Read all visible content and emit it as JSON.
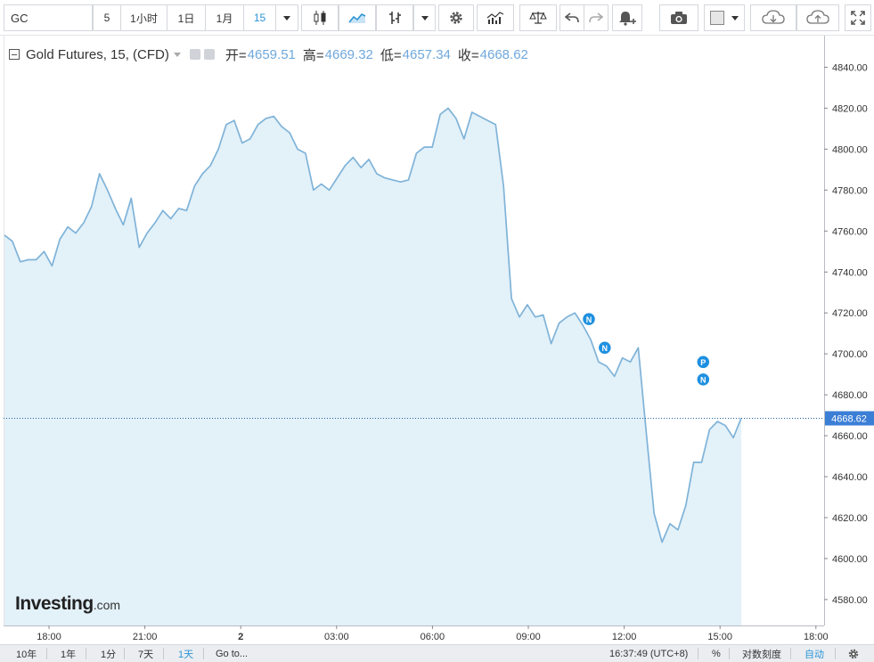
{
  "toolbar": {
    "symbol": "GC",
    "intervals": [
      "5",
      "1小时",
      "1日",
      "1月",
      "15"
    ],
    "active_interval": "15"
  },
  "legend": {
    "title": "Gold Futures, 15, (CFD)",
    "open_label": "开=",
    "open": "4659.51",
    "high_label": "高=",
    "high": "4669.32",
    "low_label": "低=",
    "low": "4657.34",
    "close_label": "收=",
    "close": "4668.62"
  },
  "logo": {
    "main": "Investing",
    "domain": ".com"
  },
  "footer": {
    "ranges": [
      "10年",
      "1年",
      "1分",
      "7天",
      "1天"
    ],
    "active_range": "1天",
    "goto": "Go to...",
    "clock": "16:37:49 (UTC+8)",
    "percent": "%",
    "log": "对数刻度",
    "auto": "自动"
  },
  "colors": {
    "line": "#7fb3d8",
    "fill": "#e3f1f9",
    "last_price_label": "#3b7ed6",
    "marker": "#1e90e0",
    "accent": "#2b95d6"
  },
  "chart_data": {
    "type": "area",
    "title": "Gold Futures, 15, (CFD)",
    "x_tick_labels": [
      "18:00",
      "21:00",
      "2",
      "03:00",
      "06:00",
      "09:00",
      "12:00",
      "15:00",
      "18:00"
    ],
    "y_ticks": [
      4580,
      4600,
      4620,
      4640,
      4660,
      4680,
      4700,
      4720,
      4740,
      4760,
      4780,
      4800,
      4820,
      4840
    ],
    "ylim": [
      4570,
      4850
    ],
    "last_price": 4668.62,
    "last_price_label": "4668.62",
    "series": [
      {
        "values": [
          4758,
          4755,
          4745,
          4746,
          4746,
          4750,
          4743,
          4756,
          4762,
          4759,
          4764,
          4772,
          4788,
          4780,
          4771,
          4763,
          4776,
          4752,
          4759,
          4764,
          4770,
          4766,
          4771,
          4770,
          4782,
          4788,
          4792,
          4800,
          4812,
          4814,
          4803,
          4805,
          4812,
          4815,
          4816,
          4811,
          4808,
          4800,
          4798,
          4780,
          4783,
          4780,
          4786,
          4792,
          4796,
          4791,
          4795,
          4788,
          4786,
          4785,
          4784,
          4785,
          4798,
          4801,
          4801,
          4817,
          4820,
          4815,
          4805,
          4818,
          4816,
          4814,
          4812,
          4782,
          4727,
          4718,
          4724,
          4718,
          4719,
          4705,
          4715,
          4718,
          4720,
          4714,
          4707,
          4696,
          4694,
          4689,
          4698,
          4696,
          4703,
          4662,
          4622,
          4608,
          4617,
          4614,
          4626,
          4647,
          4647,
          4663,
          4667,
          4665,
          4659,
          4668.62
        ]
      }
    ],
    "event_markers": [
      {
        "label": "N",
        "index": 74
      },
      {
        "label": "N",
        "index": 76
      },
      {
        "label": "P",
        "index": 90
      },
      {
        "label": "N",
        "index": 90
      }
    ],
    "grid": false,
    "legend": "top-left"
  }
}
